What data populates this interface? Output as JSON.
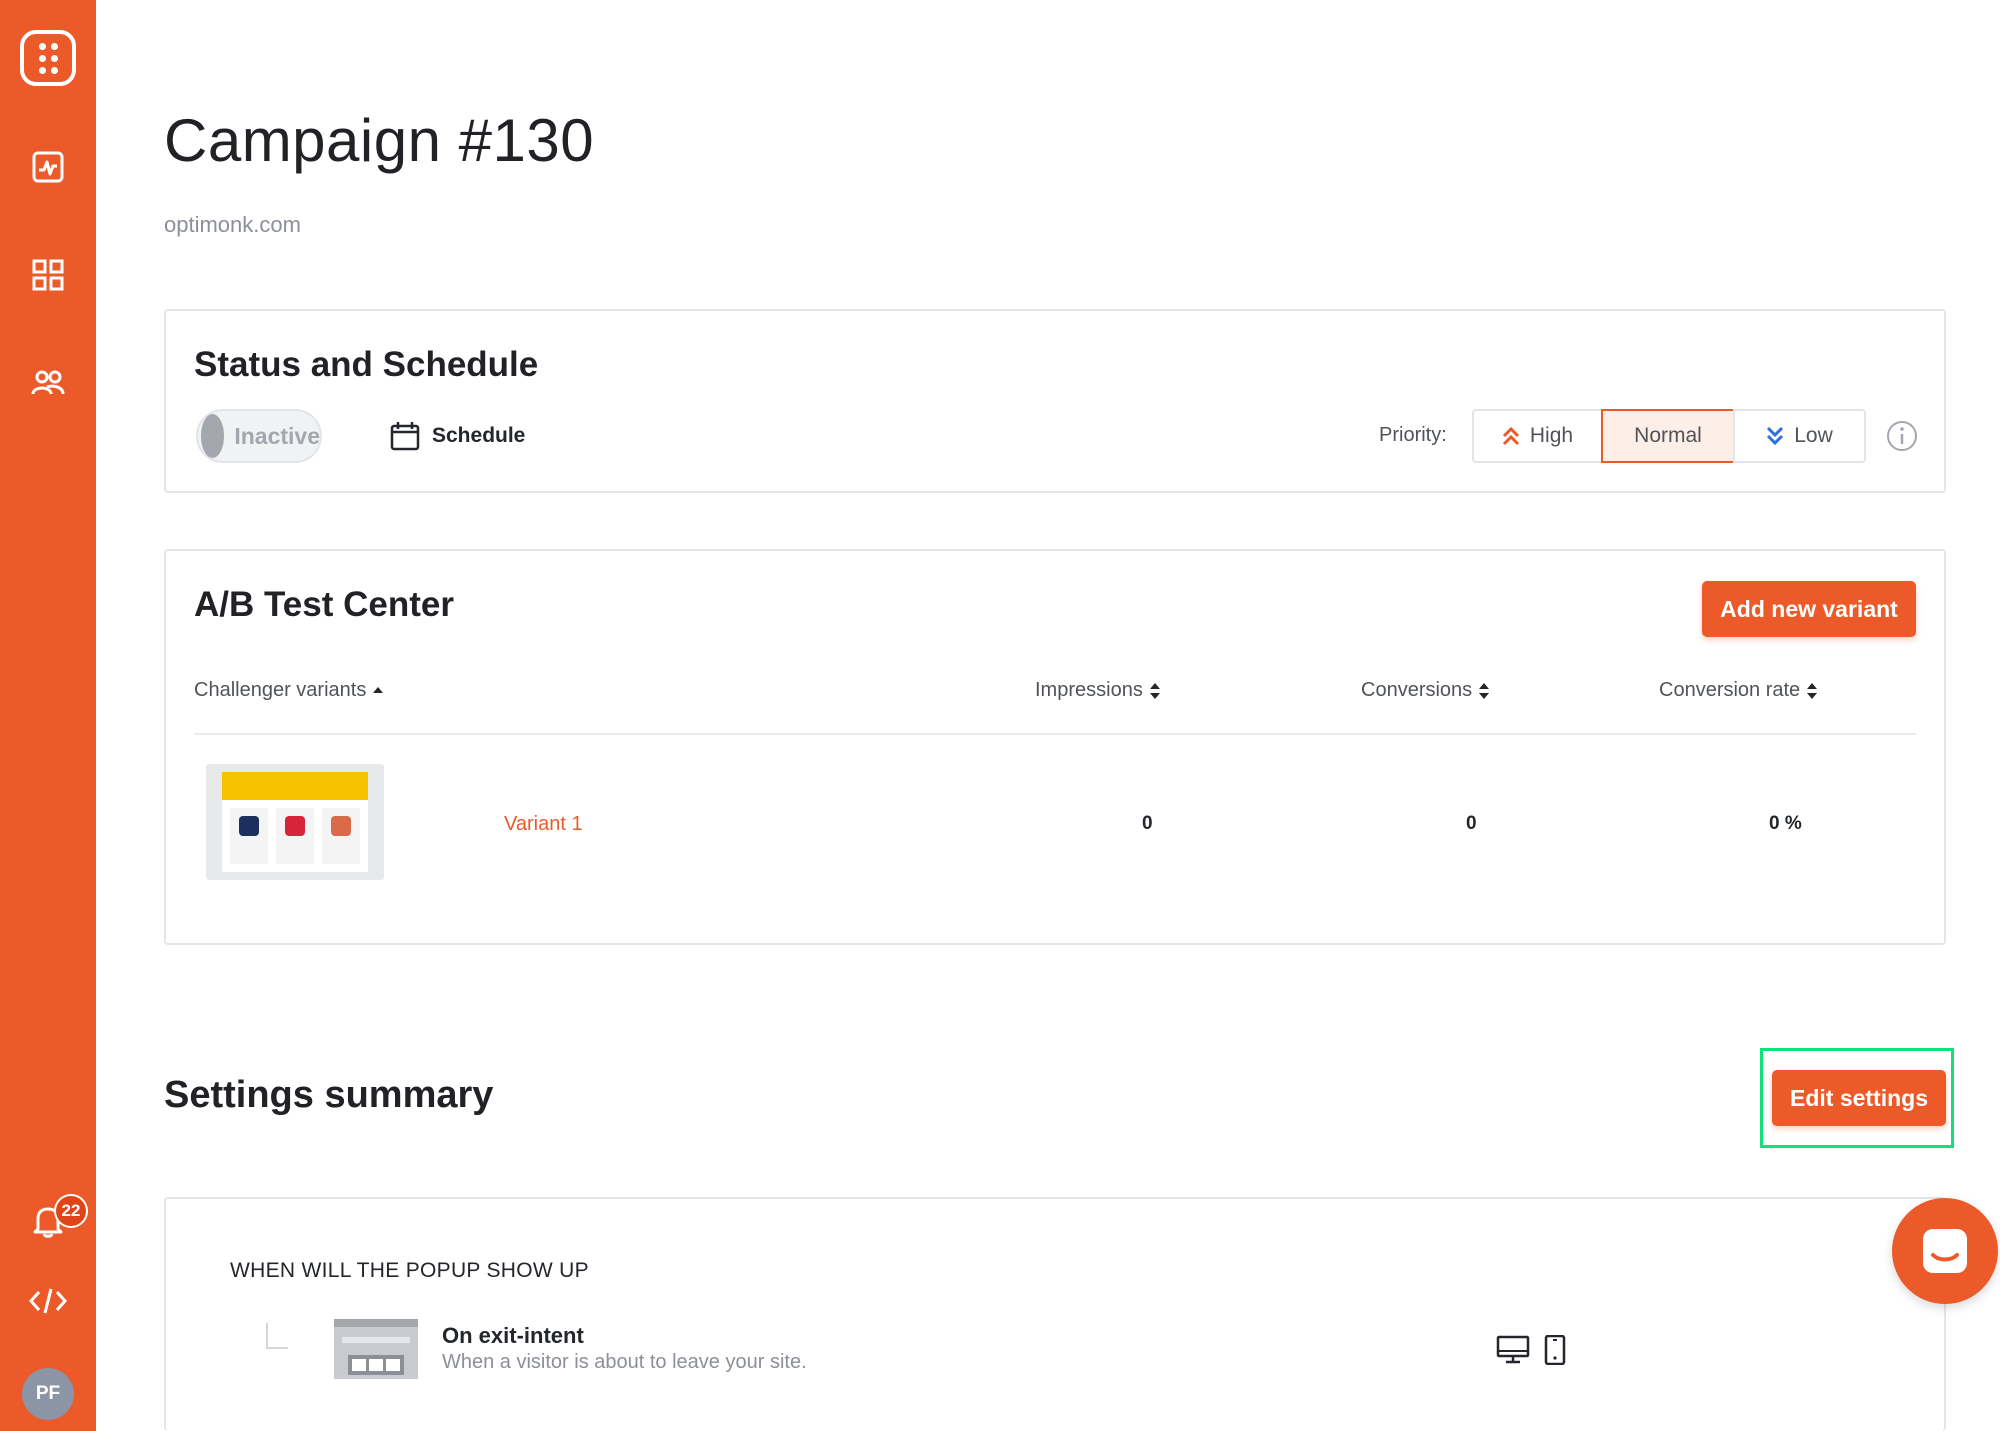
{
  "sidebar": {
    "logo_icon": "dots-grid-logo",
    "items": [
      {
        "icon": "analytics-icon"
      },
      {
        "icon": "campaigns-icon"
      },
      {
        "icon": "users-icon"
      }
    ],
    "notifications": {
      "icon": "bell-icon",
      "count": "22"
    },
    "code_icon": "code-icon",
    "avatar_initials": "PF"
  },
  "header": {
    "title": "Campaign #130",
    "domain": "optimonk.com"
  },
  "status_card": {
    "title": "Status and Schedule",
    "toggle_label": "Inactive",
    "schedule_label": "Schedule",
    "priority_label": "Priority:",
    "priority_options": [
      {
        "label": "High",
        "selected": false
      },
      {
        "label": "Normal",
        "selected": true
      },
      {
        "label": "Low",
        "selected": false
      }
    ]
  },
  "ab_card": {
    "title": "A/B Test Center",
    "add_button": "Add new variant",
    "columns": {
      "variants": "Challenger variants",
      "impressions": "Impressions",
      "conversions": "Conversions",
      "conversion_rate": "Conversion rate"
    },
    "rows": [
      {
        "name": "Variant 1",
        "impressions": "0",
        "conversions": "0",
        "conversion_rate": "0 %"
      }
    ]
  },
  "settings": {
    "title": "Settings summary",
    "edit_button": "Edit settings",
    "when_title": "WHEN WILL THE POPUP SHOW UP",
    "trigger": {
      "title": "On exit-intent",
      "description": "When a visitor is about to leave your site."
    }
  },
  "colors": {
    "brand": "#ed5a29",
    "highlight": "#14e07a",
    "blue_arrow": "#2f6fde"
  }
}
